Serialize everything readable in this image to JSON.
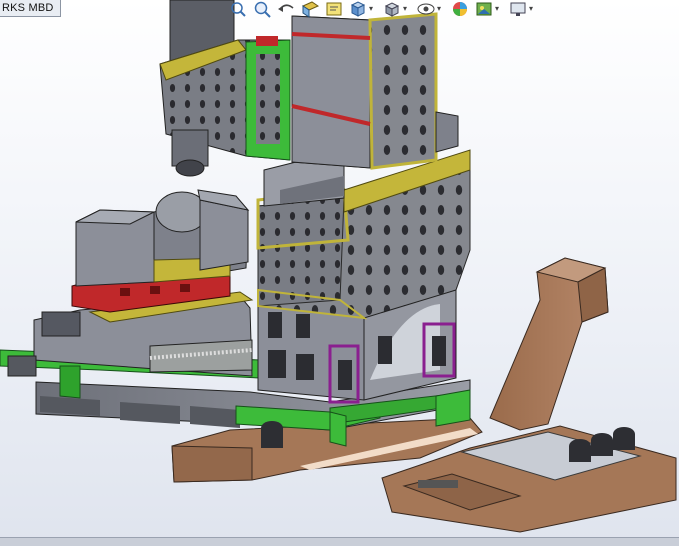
{
  "tab": {
    "label": "RKS MBD"
  },
  "toolbar": {
    "buttons": [
      {
        "icon": "zoom-to-fit-icon"
      },
      {
        "icon": "zoom-to-area-icon"
      },
      {
        "icon": "previous-view-icon"
      },
      {
        "icon": "section-view-icon"
      },
      {
        "icon": "dynamic-annotation-icon"
      },
      {
        "icon": "view-orientation-icon"
      },
      {
        "icon": "display-style-icon"
      },
      {
        "icon": "hide-show-items-icon"
      },
      {
        "icon": "edit-appearance-icon"
      },
      {
        "icon": "apply-scene-icon"
      },
      {
        "icon": "view-settings-icon"
      }
    ]
  },
  "colors": {
    "machine_gray": "#8c8f99",
    "frame_olive": "#b5a82a",
    "bed_green": "#3dbb3a",
    "saddle_red": "#c0282a",
    "chip_brown": "#a57757",
    "accent_purple": "#8a1f8f",
    "motor_dark": "#2d2e33"
  }
}
